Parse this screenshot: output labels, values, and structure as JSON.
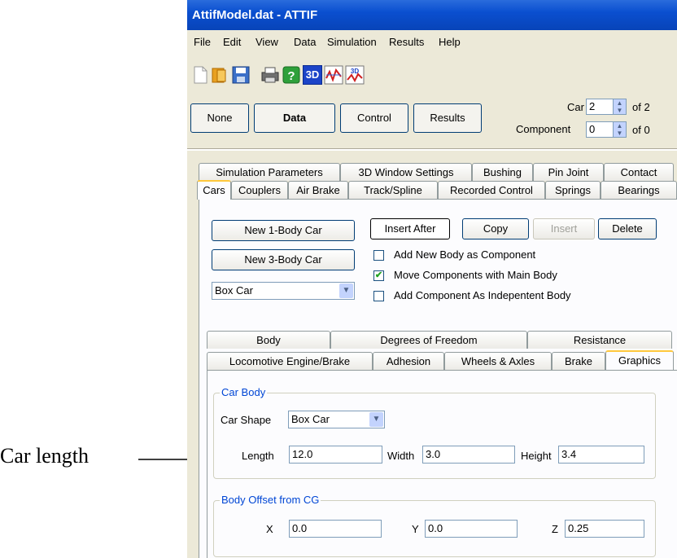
{
  "window": {
    "title": "AttifModel.dat - ATTIF"
  },
  "menu": [
    "File",
    "Edit",
    "View",
    "Data",
    "Simulation",
    "Results",
    "Help"
  ],
  "toolbar_icons": [
    "new-file-icon",
    "open-file-icon",
    "save-icon",
    "print-icon",
    "help-icon",
    "3d-view-icon",
    "plot-icon",
    "3d-plot-icon"
  ],
  "toolbar_text": {
    "3d": "3D",
    "3d_small": "3D"
  },
  "mode_buttons": [
    "None",
    "Data",
    "Control",
    "Results"
  ],
  "selector": {
    "car_label": "Car",
    "car_value": "2",
    "car_of": "of 2",
    "component_label": "Component",
    "component_value": "0",
    "component_of": "of 0"
  },
  "tabs_row1": [
    "Simulation Parameters",
    "3D Window Settings",
    "Bushing",
    "Pin Joint",
    "Contact"
  ],
  "tabs_row2": [
    "Cars",
    "Couplers",
    "Air Brake",
    "Track/Spline",
    "Recorded Control",
    "Springs",
    "Bearings"
  ],
  "cars": {
    "new_1body": "New 1-Body Car",
    "new_3body": "New 3-Body Car",
    "car_type": "Box Car",
    "insert_after": "Insert After",
    "copy": "Copy",
    "insert": "Insert",
    "delete": "Delete",
    "check_add_body": "Add New Body as Component",
    "check_move": "Move Components with Main Body",
    "check_independent": "Add Component As Indepentent Body",
    "check_states": [
      false,
      true,
      false
    ]
  },
  "subtabs_row1": [
    "Body",
    "Degrees of Freedom",
    "Resistance"
  ],
  "subtabs_row2": [
    "Locomotive Engine/Brake",
    "Adhesion",
    "Wheels & Axles",
    "Brake",
    "Graphics"
  ],
  "car_body": {
    "group_label": "Car Body",
    "shape_label": "Car Shape",
    "shape_value": "Box Car",
    "length_label": "Length",
    "length_value": "12.0",
    "width_label": "Width",
    "width_value": "3.0",
    "height_label": "Height",
    "height_value": "3.4"
  },
  "offset": {
    "group_label": "Body Offset from CG",
    "x_label": "X",
    "x_value": "0.0",
    "y_label": "Y",
    "y_value": "0.0",
    "z_label": "Z",
    "z_value": "0.25"
  },
  "annotation": {
    "text": "Car length"
  },
  "colors": {
    "titlebar": "#0a4fd0",
    "face": "#ece9d8",
    "group_label": "#0046d5",
    "active_tab": "#ffc83c"
  }
}
